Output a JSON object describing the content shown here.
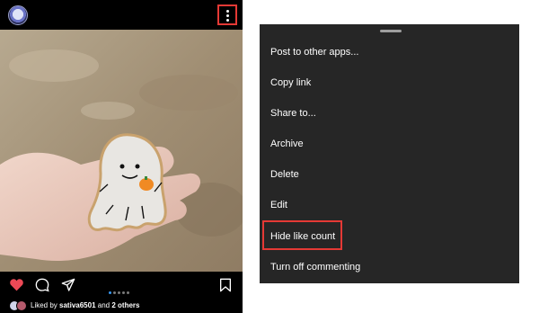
{
  "post": {
    "liked_prefix": "Liked by",
    "liked_user": "sativa6501",
    "liked_and": "and",
    "liked_others": "2 others",
    "carousel_count": 5,
    "carousel_active_index": 0
  },
  "menu": {
    "items": [
      {
        "label": "Post to other apps..."
      },
      {
        "label": "Copy link"
      },
      {
        "label": "Share to..."
      },
      {
        "label": "Archive"
      },
      {
        "label": "Delete"
      },
      {
        "label": "Edit"
      },
      {
        "label": "Hide like count"
      },
      {
        "label": "Turn off commenting"
      }
    ]
  },
  "colors": {
    "highlight": "#e53935",
    "like": "#ed4956",
    "sheet": "#262626"
  },
  "icons": [
    "more-options-icon",
    "heart-icon",
    "comment-icon",
    "share-icon",
    "bookmark-icon"
  ]
}
